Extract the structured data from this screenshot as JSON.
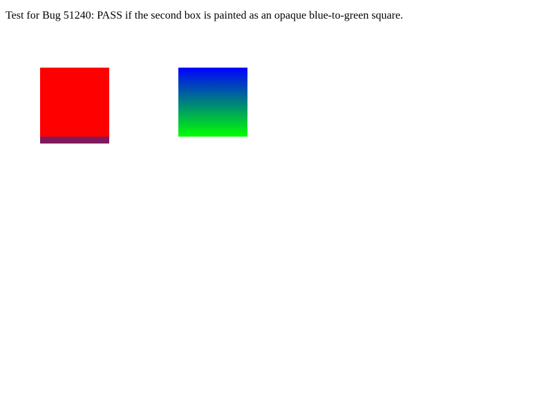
{
  "description": "Test for Bug 51240: PASS if the second box is painted as an opaque blue-to-green square.",
  "colors": {
    "first_box": "#ff0000",
    "first_box_strip": "#801a5a",
    "gradient_start": "#0000ff",
    "gradient_end": "#00ff00"
  }
}
